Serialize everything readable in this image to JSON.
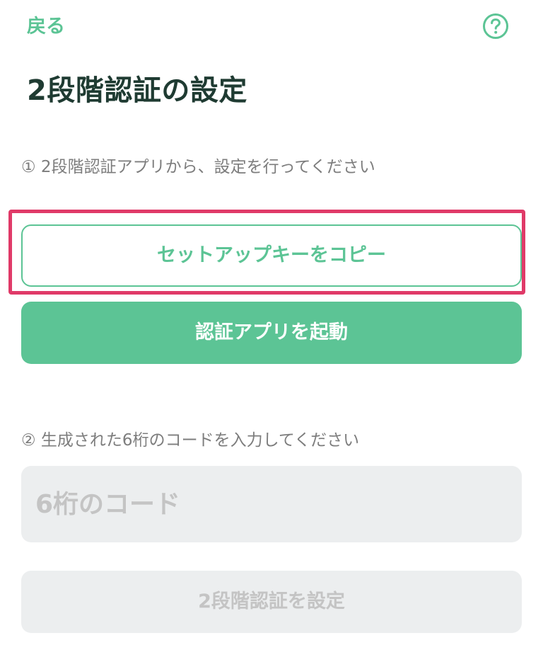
{
  "header": {
    "back_label": "戻る",
    "help_icon": "question-circle-icon",
    "title": "2段階認証の設定"
  },
  "step1": {
    "label": "① 2段階認証アプリから、設定を行ってください",
    "copy_button": "セットアップキーをコピー",
    "launch_button": "認証アプリを起動"
  },
  "step2": {
    "label": "② 生成された6桁のコードを入力してください",
    "code_placeholder": "6桁のコード",
    "code_value": "",
    "submit_button": "2段階認証を設定"
  },
  "colors": {
    "accent": "#5cc495",
    "title": "#1f3b32",
    "highlight": "#e03a68",
    "disabled_bg": "#eceeef",
    "disabled_text": "#c4c4c4"
  }
}
